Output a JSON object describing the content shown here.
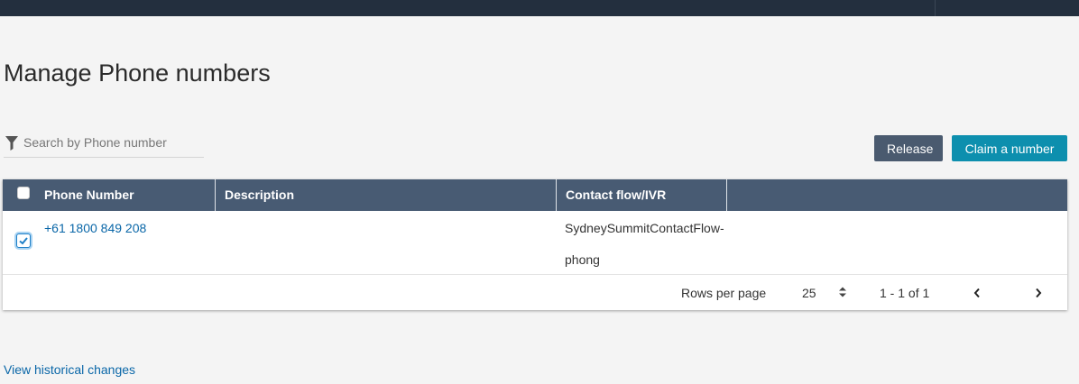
{
  "page": {
    "title": "Manage Phone numbers"
  },
  "search": {
    "placeholder": "Search by Phone number",
    "icon": "filter-icon"
  },
  "actions": {
    "release_label": "Release",
    "claim_label": "Claim a number",
    "release_color": "#4a5a6f",
    "claim_color": "#0d8fae"
  },
  "table": {
    "header_color": "#485b73",
    "columns": [
      "Phone Number",
      "Description",
      "Contact flow/IVR"
    ],
    "rows": [
      {
        "selected": true,
        "phone_number": "+61 1800 849 208",
        "description": "",
        "contact_flow_line1": "SydneySummitContactFlow-",
        "contact_flow_line2": "phong"
      }
    ]
  },
  "pagination": {
    "rows_per_page_label": "Rows per page",
    "rows_per_page_value": "25",
    "range_text": "1 - 1 of 1"
  },
  "footer": {
    "history_link": "View historical changes"
  }
}
